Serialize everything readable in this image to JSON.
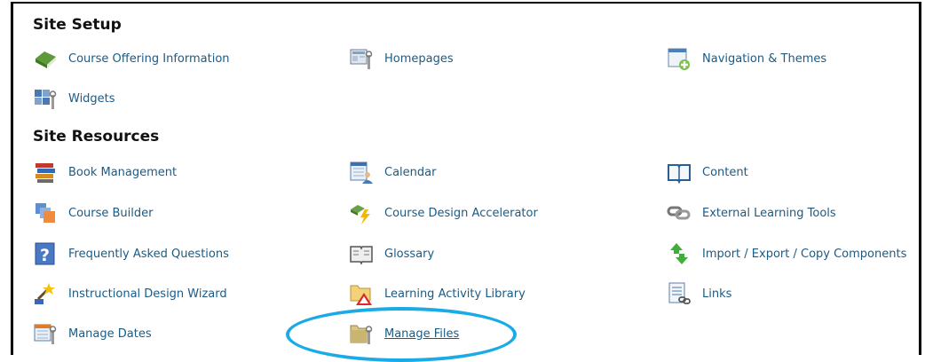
{
  "site_setup": {
    "title": "Site Setup",
    "items": [
      {
        "label": "Course Offering Information",
        "icon": "book-green-icon"
      },
      {
        "label": "Homepages",
        "icon": "homepage-config-icon"
      },
      {
        "label": "Navigation & Themes",
        "icon": "navigation-plus-icon"
      },
      {
        "label": "Widgets",
        "icon": "widgets-config-icon"
      }
    ]
  },
  "site_resources": {
    "title": "Site Resources",
    "items": [
      {
        "label": "Book Management",
        "icon": "books-stack-icon"
      },
      {
        "label": "Calendar",
        "icon": "calendar-user-icon"
      },
      {
        "label": "Content",
        "icon": "open-book-icon"
      },
      {
        "label": "Course Builder",
        "icon": "course-builder-icon"
      },
      {
        "label": "Course Design Accelerator",
        "icon": "lightning-book-icon"
      },
      {
        "label": "External Learning Tools",
        "icon": "chain-link-icon"
      },
      {
        "label": "Frequently Asked Questions",
        "icon": "question-mark-icon"
      },
      {
        "label": "Glossary",
        "icon": "glossary-book-icon"
      },
      {
        "label": "Import / Export / Copy Components",
        "icon": "arrows-up-down-icon"
      },
      {
        "label": "Instructional Design Wizard",
        "icon": "wizard-wand-icon"
      },
      {
        "label": "Learning Activity Library",
        "icon": "folder-warning-icon"
      },
      {
        "label": "Links",
        "icon": "links-document-icon"
      },
      {
        "label": "Manage Dates",
        "icon": "manage-dates-icon"
      },
      {
        "label": "Manage Files",
        "icon": "folder-config-icon"
      }
    ]
  },
  "colors": {
    "link": "#1a5b86",
    "highlight": "#1aabe6"
  }
}
